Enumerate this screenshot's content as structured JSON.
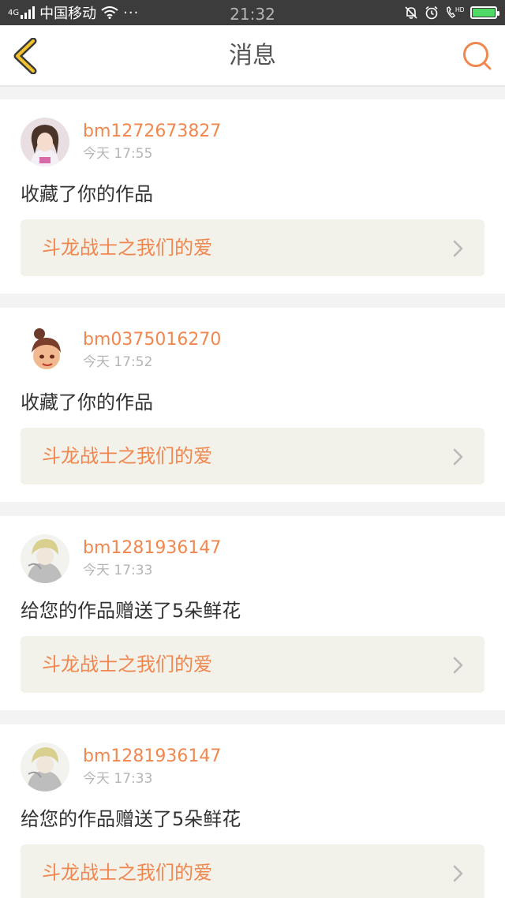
{
  "status_bar": {
    "network": "4G",
    "carrier": "中国移动",
    "time": "21:32"
  },
  "nav": {
    "title": "消息"
  },
  "colors": {
    "accent": "#f0874e",
    "back": "#f2c32a"
  },
  "messages": [
    {
      "username": "bm1272673827",
      "time": "今天 17:55",
      "action": "收藏了你的作品",
      "work_title": "斗龙战士之我们的爱"
    },
    {
      "username": "bm0375016270",
      "time": "今天 17:52",
      "action": "收藏了你的作品",
      "work_title": "斗龙战士之我们的爱"
    },
    {
      "username": "bm1281936147",
      "time": "今天 17:33",
      "action": "给您的作品赠送了5朵鲜花",
      "work_title": "斗龙战士之我们的爱"
    },
    {
      "username": "bm1281936147",
      "time": "今天 17:33",
      "action": "给您的作品赠送了5朵鲜花",
      "work_title": "斗龙战士之我们的爱"
    }
  ]
}
